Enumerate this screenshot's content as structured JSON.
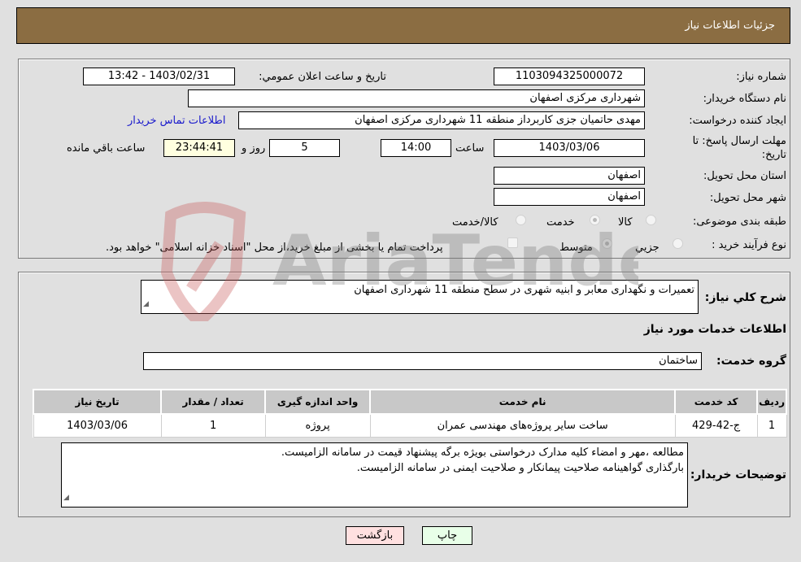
{
  "header": {
    "title": "جزئیات اطلاعات نیاز"
  },
  "form": {
    "need_number": {
      "label": "شماره نیاز:",
      "value": "1103094325000072"
    },
    "announce_datetime": {
      "label": "تاریخ و ساعت اعلان عمومي:",
      "value": "1403/02/31 - 13:42"
    },
    "buyer_org": {
      "label": "نام دستگاه خریدار:",
      "value": "شهرداری مرکزی اصفهان"
    },
    "requester": {
      "label": "ایجاد کننده درخواست:",
      "value": "مهدی حاتمیان جزی کاربرداز منطقه 11 شهرداری مرکزی اصفهان"
    },
    "buyer_contact_link": "اطلاعات تماس خریدار",
    "deadline": {
      "label_line1": "مهلت ارسال پاسخ: تا",
      "label_line2": "تاریخ:",
      "date": "1403/03/06",
      "time_label": "ساعت",
      "time": "14:00",
      "days": "5",
      "days_label": "روز و",
      "remaining": "23:44:41",
      "remaining_label": "ساعت باقي مانده"
    },
    "delivery_province": {
      "label": "استان محل تحویل:",
      "value": "اصفهان"
    },
    "delivery_city": {
      "label": "شهر محل تحویل:",
      "value": "اصفهان"
    },
    "category": {
      "label": "طبقه بندی موضوعی:",
      "options": [
        {
          "label": "کالا",
          "selected": false
        },
        {
          "label": "خدمت",
          "selected": true
        },
        {
          "label": "کالا/خدمت",
          "selected": false
        }
      ]
    },
    "purchase_type": {
      "label": "نوع فرآیند خرید :",
      "options": [
        {
          "label": "جزيي",
          "selected": false
        },
        {
          "label": "متوسط",
          "selected": true
        }
      ],
      "treasury_note": "پرداخت تمام یا بخشی از مبلغ خرید،از محل \"اسناد خزانه اسلامی\" خواهد بود.",
      "treasury_checked": false
    }
  },
  "details": {
    "general_desc_label": "شرح کلي نیاز:",
    "general_desc": "تعمیرات و نگهداری معابر و ابنیه شهری در سطح منطقه 11 شهرداری اصفهان",
    "services_title": "اطلاعات خدمات مورد نیاز",
    "service_group_label": "گروه خدمت:",
    "service_group": "ساختمان",
    "table": {
      "headers": [
        "ردیف",
        "کد خدمت",
        "نام خدمت",
        "واحد اندازه گیری",
        "تعداد / مقدار",
        "تاریخ نیاز"
      ],
      "rows": [
        [
          "1",
          "ج-42-429",
          "ساخت سایر پروژه‌های مهندسی عمران",
          "پروژه",
          "1",
          "1403/03/06"
        ]
      ]
    },
    "buyer_notes_label": "توضیحات خریدار:",
    "buyer_notes_line1": "مطالعه ،مهر و امضاء کلیه مدارک درخواستی بویژه برگه پیشنهاد قیمت در سامانه الزامیست.",
    "buyer_notes_line2": "بارگذاری گواهینامه صلاحیت پیمانکار و صلاحیت ایمنی در سامانه الزامیست."
  },
  "buttons": {
    "print": "چاپ",
    "back": "بازگشت"
  },
  "watermark": {
    "text": "AriaTender.neT"
  }
}
